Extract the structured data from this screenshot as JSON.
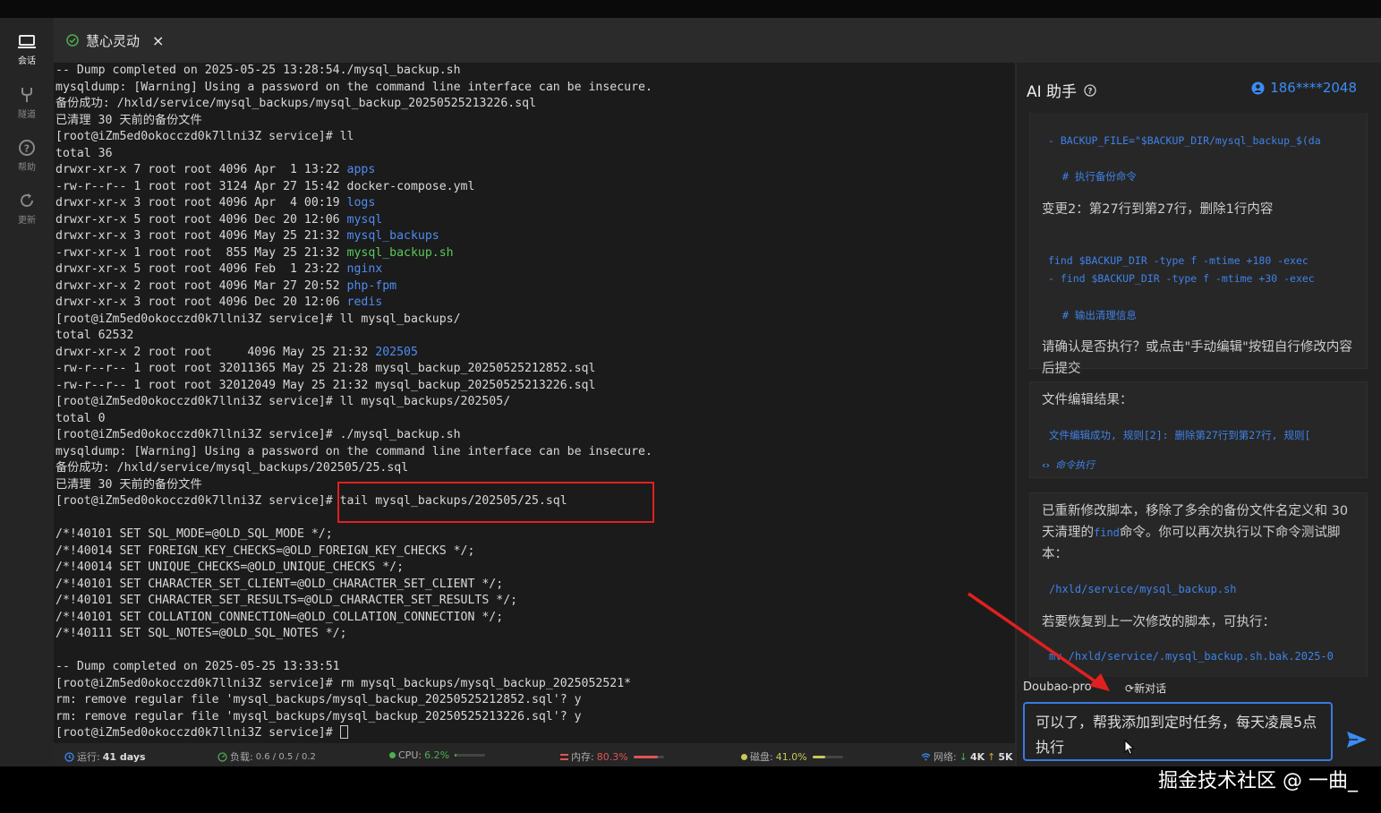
{
  "nav": {
    "items": [
      {
        "label": "会话",
        "icon": "laptop-icon"
      },
      {
        "label": "隧道",
        "icon": "fork-icon"
      },
      {
        "label": "帮助",
        "icon": "help-icon"
      },
      {
        "label": "更新",
        "icon": "refresh-icon"
      }
    ]
  },
  "tab": {
    "label": "慧心灵动",
    "close": "×"
  },
  "terminal": {
    "lines": [
      [
        {
          "t": "-- Dump completed on 2025-05-25 13:28:54./mysql_backup.sh"
        }
      ],
      [
        {
          "t": "mysqldump: [Warning] Using a password on the command line interface can be insecure."
        }
      ],
      [
        {
          "t": "备份成功: /hxld/service/mysql_backups/mysql_backup_20250525213226.sql"
        }
      ],
      [
        {
          "t": "已清理 30 天前的备份文件"
        }
      ],
      [
        {
          "t": "[root@iZm5ed0okocczd0k7llni3Z service]# ll"
        }
      ],
      [
        {
          "t": "total 36"
        }
      ],
      [
        {
          "t": "drwxr-xr-x 7 root root 4096 Apr  1 13:22 "
        },
        {
          "t": "apps",
          "c": "blue"
        }
      ],
      [
        {
          "t": "-rw-r--r-- 1 root root 3124 Apr 27 15:42 docker-compose.yml"
        }
      ],
      [
        {
          "t": "drwxr-xr-x 3 root root 4096 Apr  4 00:19 "
        },
        {
          "t": "logs",
          "c": "blue"
        }
      ],
      [
        {
          "t": "drwxr-xr-x 5 root root 4096 Dec 20 12:06 "
        },
        {
          "t": "mysql",
          "c": "blue"
        }
      ],
      [
        {
          "t": "drwxr-xr-x 3 root root 4096 May 25 21:32 "
        },
        {
          "t": "mysql_backups",
          "c": "blue"
        }
      ],
      [
        {
          "t": "-rwxr-xr-x 1 root root  855 May 25 21:32 "
        },
        {
          "t": "mysql_backup.sh",
          "c": "green"
        }
      ],
      [
        {
          "t": "drwxr-xr-x 5 root root 4096 Feb  1 23:22 "
        },
        {
          "t": "nginx",
          "c": "blue"
        }
      ],
      [
        {
          "t": "drwxr-xr-x 2 root root 4096 Mar 27 20:52 "
        },
        {
          "t": "php-fpm",
          "c": "blue"
        }
      ],
      [
        {
          "t": "drwxr-xr-x 3 root root 4096 Dec 20 12:06 "
        },
        {
          "t": "redis",
          "c": "blue"
        }
      ],
      [
        {
          "t": "[root@iZm5ed0okocczd0k7llni3Z service]# ll mysql_backups/"
        }
      ],
      [
        {
          "t": "total 62532"
        }
      ],
      [
        {
          "t": "drwxr-xr-x 2 root root     4096 May 25 21:32 "
        },
        {
          "t": "202505",
          "c": "blue"
        }
      ],
      [
        {
          "t": "-rw-r--r-- 1 root root 32011365 May 25 21:28 mysql_backup_20250525212852.sql"
        }
      ],
      [
        {
          "t": "-rw-r--r-- 1 root root 32012049 May 25 21:32 mysql_backup_20250525213226.sql"
        }
      ],
      [
        {
          "t": "[root@iZm5ed0okocczd0k7llni3Z service]# ll mysql_backups/202505/"
        }
      ],
      [
        {
          "t": "total 0"
        }
      ],
      [
        {
          "t": "[root@iZm5ed0okocczd0k7llni3Z service]# ./mysql_backup.sh"
        }
      ],
      [
        {
          "t": "mysqldump: [Warning] Using a password on the command line interface can be insecure."
        }
      ],
      [
        {
          "t": "备份成功: /hxld/service/mysql_backups/202505/25.sql"
        }
      ],
      [
        {
          "t": "已清理 30 天前的备份文件"
        }
      ],
      [
        {
          "t": "[root@iZm5ed0okocczd0k7llni3Z service]# tail mysql_backups/202505/25.sql"
        }
      ],
      [
        {
          "t": ""
        }
      ],
      [
        {
          "t": "/*!40101 SET SQL_MODE=@OLD_SQL_MODE */;"
        }
      ],
      [
        {
          "t": "/*!40014 SET FOREIGN_KEY_CHECKS=@OLD_FOREIGN_KEY_CHECKS */;"
        }
      ],
      [
        {
          "t": "/*!40014 SET UNIQUE_CHECKS=@OLD_UNIQUE_CHECKS */;"
        }
      ],
      [
        {
          "t": "/*!40101 SET CHARACTER_SET_CLIENT=@OLD_CHARACTER_SET_CLIENT */;"
        }
      ],
      [
        {
          "t": "/*!40101 SET CHARACTER_SET_RESULTS=@OLD_CHARACTER_SET_RESULTS */;"
        }
      ],
      [
        {
          "t": "/*!40101 SET COLLATION_CONNECTION=@OLD_COLLATION_CONNECTION */;"
        }
      ],
      [
        {
          "t": "/*!40111 SET SQL_NOTES=@OLD_SQL_NOTES */;"
        }
      ],
      [
        {
          "t": ""
        }
      ],
      [
        {
          "t": "-- Dump completed on 2025-05-25 13:33:51"
        }
      ],
      [
        {
          "t": "[root@iZm5ed0okocczd0k7llni3Z service]# rm mysql_backups/mysql_backup_2025052521*"
        }
      ],
      [
        {
          "t": "rm: remove regular file 'mysql_backups/mysql_backup_20250525212852.sql'? y"
        }
      ],
      [
        {
          "t": "rm: remove regular file 'mysql_backups/mysql_backup_20250525213226.sql'? y"
        }
      ],
      [
        {
          "t": "[root@iZm5ed0okocczd0k7llni3Z service]# "
        },
        {
          "cursor": true
        }
      ]
    ]
  },
  "status": {
    "uptime_label": "运行:",
    "uptime_value": "41 days",
    "load_label": "负载:",
    "load_value": "0.6 / 0.5 / 0.2",
    "cpu_label": "CPU:",
    "cpu_value": "6.2%",
    "cpu_level": 0.062,
    "mem_label": "内存:",
    "mem_value": "80.3%",
    "mem_level": 0.803,
    "disk_label": "磁盘:",
    "disk_value": "41.0%",
    "disk_level": 0.41,
    "net_label": "网络:",
    "net_down": "4K",
    "net_up": "5K"
  },
  "ai": {
    "title": "AI 助手",
    "user": "186****2048",
    "card1": {
      "code1": "- BACKUP_FILE=\"$BACKUP_DIR/mysql_backup_$(da",
      "code2": "# 执行备份命令",
      "change": "变更2：第27行到第27行，删除1行内容",
      "code3": "  find $BACKUP_DIR -type f -mtime +180 -exec",
      "code4": "- find $BACKUP_DIR -type f -mtime +30 -exec",
      "code5": "# 输出清理信息",
      "confirm": "请确认是否执行？或点击\"手动编辑\"按钮自行修改内容后提交"
    },
    "card2": {
      "title": "文件编辑结果：",
      "result": "文件编辑成功, 规则[2]: 删除第27行到第27行, 规则[",
      "exec": "命令执行"
    },
    "card3": {
      "text1a": "已重新修改脚本，移除了多余的备份文件名定义和 30 天清理的",
      "find": "find",
      "text1b": "命令。你可以再次执行以下命令测试脚本：",
      "cmd1": "/hxld/service/mysql_backup.sh",
      "text2": "若要恢复到上一次修改的脚本，可执行：",
      "cmd2": "mv /hxld/service/.mysql_backup.sh.bak.2025-0"
    },
    "model": "Doubao-pro",
    "new_chat": "新对话",
    "input_value": "可以了，帮我添加到定时任务，每天凌晨5点执行"
  },
  "watermark": "掘金技术社区 @ 一曲_",
  "colors": {
    "accent": "#3b8cf5",
    "highlight": "#e02020",
    "dir": "#4f8cf0",
    "exec": "#5bc85b"
  }
}
